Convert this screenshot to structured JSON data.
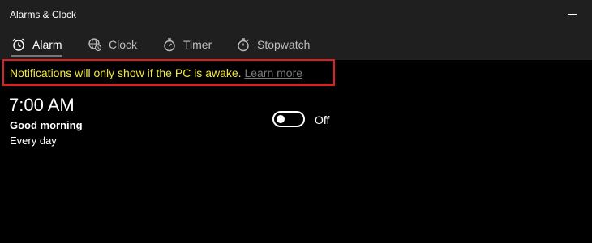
{
  "window": {
    "title": "Alarms & Clock",
    "minimize_icon": "minimize-icon"
  },
  "tabs": [
    {
      "label": "Alarm",
      "icon": "alarm-icon",
      "selected": true
    },
    {
      "label": "Clock",
      "icon": "world-clock-icon",
      "selected": false
    },
    {
      "label": "Timer",
      "icon": "timer-icon",
      "selected": false
    },
    {
      "label": "Stopwatch",
      "icon": "stopwatch-icon",
      "selected": false
    }
  ],
  "notice": {
    "message": "Notifications will only show if the PC is awake.",
    "link": "Learn more",
    "message_color": "#f2e83c",
    "highlight_color": "#e01e1e"
  },
  "alarm": {
    "time": "7:00 AM",
    "name": "Good morning",
    "repeat": "Every day",
    "toggle_state": "Off"
  }
}
